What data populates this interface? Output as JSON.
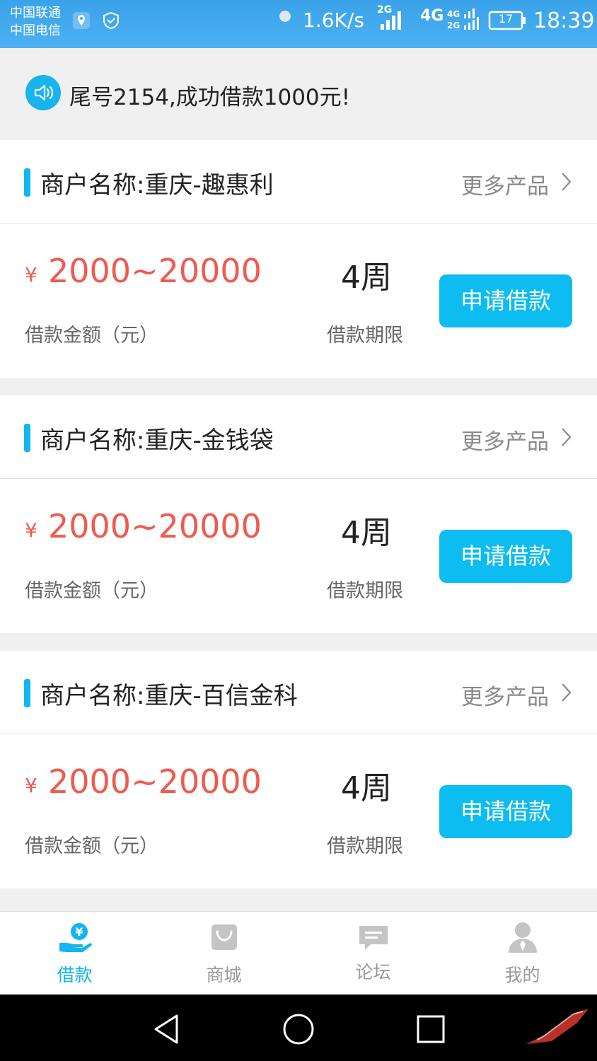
{
  "status_bar": {
    "carrier_1": "中国联通",
    "carrier_2": "中国电信",
    "speed": "1.6K/s",
    "net_2g": "2G",
    "net_4g": "4G",
    "battery": "17",
    "time": "18:39"
  },
  "notice": {
    "text": "尾号2154,成功借款1000元!",
    "icon": "speaker-icon"
  },
  "cards": [
    {
      "merchant": "商户名称:重庆-趣惠利",
      "more": "更多产品",
      "currency": "¥",
      "amount": "2000~20000",
      "amount_label": "借款金额（元）",
      "term": "4周",
      "term_label": "借款期限",
      "button": "申请借款"
    },
    {
      "merchant": "商户名称:重庆-金钱袋",
      "more": "更多产品",
      "currency": "¥",
      "amount": "2000~20000",
      "amount_label": "借款金额（元）",
      "term": "4周",
      "term_label": "借款期限",
      "button": "申请借款"
    },
    {
      "merchant": "商户名称:重庆-百信金科",
      "more": "更多产品",
      "currency": "¥",
      "amount": "2000~20000",
      "amount_label": "借款金额（元）",
      "term": "4周",
      "term_label": "借款期限",
      "button": "申请借款"
    }
  ],
  "tabbar": {
    "tabs": [
      {
        "label": "借款",
        "icon": "loan-icon",
        "active": true
      },
      {
        "label": "商城",
        "icon": "shopping-bag-icon",
        "active": false
      },
      {
        "label": "论坛",
        "icon": "chat-bubble-icon",
        "active": false
      },
      {
        "label": "我的",
        "icon": "user-icon",
        "active": false
      }
    ]
  },
  "colors": {
    "accent": "#12b5ef",
    "amount": "#f05a4f",
    "status_bar": "#43aaee",
    "inactive": "#999999"
  }
}
